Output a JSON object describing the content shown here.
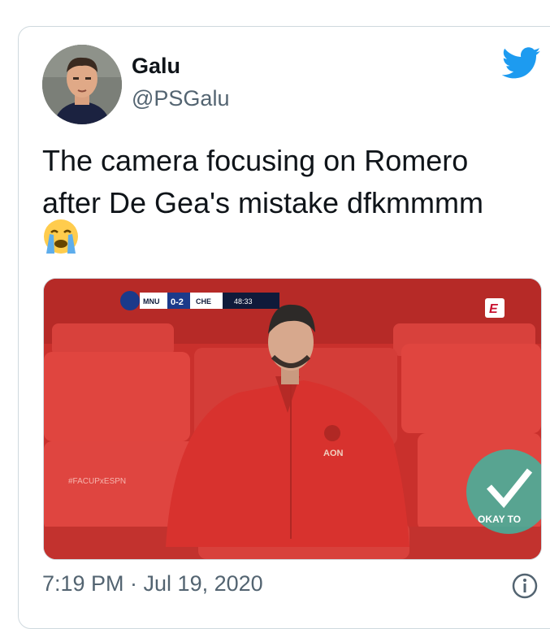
{
  "tweet": {
    "display_name": "Galu",
    "handle": "@PSGalu",
    "text": "The camera focusing on Romero after De Gea's mistake dfkmmmm",
    "timestamp": "7:19 PM · Jul 19, 2020"
  },
  "media": {
    "scorebug": {
      "home": "MNU",
      "score": "0-2",
      "away": "CHE",
      "clock": "48:33"
    },
    "hashtag": "#FACUPxESPN",
    "sponsor": "AON",
    "watermark": "OKAY TO"
  },
  "colors": {
    "twitter_blue": "#1d9bf0",
    "seat_red": "#e0453f",
    "jacket_red": "#d8322e"
  },
  "icons": {
    "brand": "twitter-bird-icon",
    "emoji": "loudly-crying-face-icon",
    "info": "info-icon"
  }
}
